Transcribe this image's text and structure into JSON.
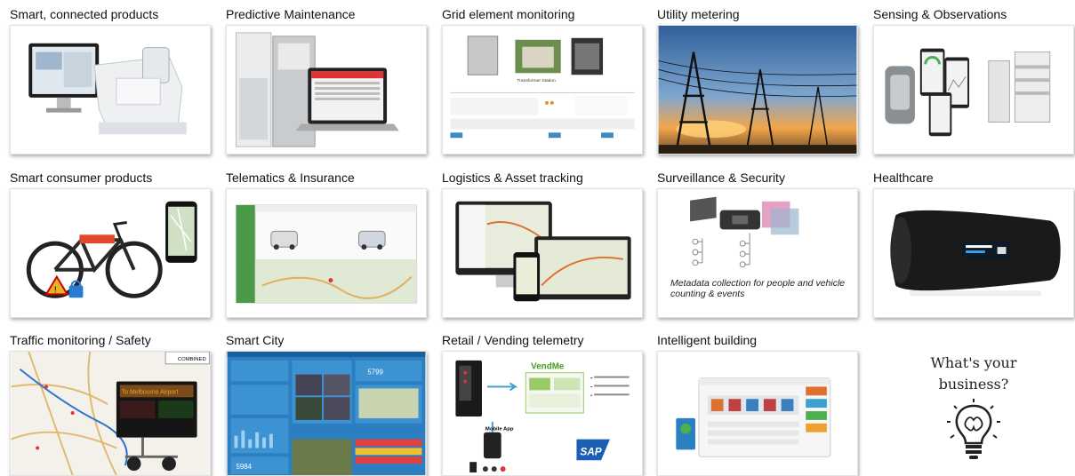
{
  "tiles": [
    {
      "label": "Smart, connected products"
    },
    {
      "label": "Predictive Maintenance"
    },
    {
      "label": "Grid element monitoring"
    },
    {
      "label": "Utility metering"
    },
    {
      "label": "Sensing & Observations"
    },
    {
      "label": "Smart consumer products"
    },
    {
      "label": "Telematics & Insurance"
    },
    {
      "label": "Logistics & Asset tracking"
    },
    {
      "label": "Surveillance & Security",
      "caption": "Metadata collection for people and vehicle counting & events"
    },
    {
      "label": "Healthcare"
    },
    {
      "label": "Traffic monitoring / Safety"
    },
    {
      "label": "Smart City"
    },
    {
      "label": "Retail / Vending telemetry"
    },
    {
      "label": "Intelligent building"
    }
  ],
  "cta": {
    "line1": "What's your",
    "line2": "business?",
    "icon": "lightbulb-brain-icon"
  },
  "embedded_text": {
    "grid_station": "Transformer Station",
    "traffic_sign": "To Melbourne Airport",
    "traffic_map_title": "COMBINED",
    "smartcity_counts": [
      "5984",
      "5799"
    ],
    "vending_brand": "VendMe",
    "vending_app": "Mobile App",
    "sap": "SAP"
  }
}
